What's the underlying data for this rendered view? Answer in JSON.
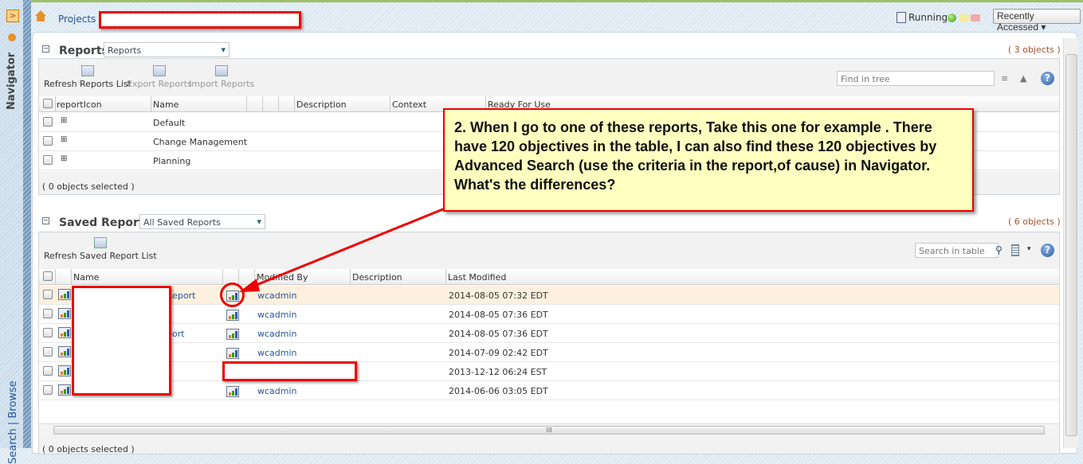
{
  "nav": {
    "title": "Navigator",
    "search_tab": "Search",
    "browse_tab": "Browse",
    "separator": "|"
  },
  "header": {
    "breadcrumb_root": "Projects",
    "breadcrumb_sep": ">",
    "status": "Running",
    "recently_accessed": "Recently Accessed"
  },
  "reports": {
    "title": "Reports",
    "selector": "Reports",
    "count": "( 3 objects )",
    "toolbar": [
      "Refresh Reports List",
      "Export Reports",
      "Import Reports"
    ],
    "find_placeholder": "Find in tree",
    "columns": [
      "reportIcon",
      "Name",
      "",
      "",
      "",
      "Description",
      "Context",
      "Ready For Use"
    ],
    "rows": [
      "Default",
      "Change Management",
      "Planning"
    ],
    "selected": "( 0 objects selected )"
  },
  "saved_reports": {
    "title": "Saved Reports",
    "selector": "All Saved Reports",
    "count": "( 6 objects )",
    "toolbar": [
      "Refresh Saved Report List"
    ],
    "search_placeholder": "Search in table",
    "columns": [
      "Name",
      "Modified By",
      "Description",
      "Last Modified"
    ],
    "rows": [
      {
        "name": "Report",
        "modified_by": "wcadmin",
        "last_modified": "2014-08-05 07:32 EDT"
      },
      {
        "name": "",
        "modified_by": "wcadmin",
        "last_modified": "2014-08-05 07:36 EDT"
      },
      {
        "name": "port",
        "modified_by": "wcadmin",
        "last_modified": "2014-08-05 07:36 EDT"
      },
      {
        "name": "t",
        "modified_by": "wcadmin",
        "last_modified": "2014-07-09 02:42 EDT"
      },
      {
        "name": "",
        "modified_by": "",
        "last_modified": "2013-12-12 06:24 EST"
      },
      {
        "name": "",
        "modified_by": "wcadmin",
        "last_modified": "2014-06-06 03:05 EDT"
      }
    ],
    "selected": "( 0 objects selected )"
  },
  "annotation": {
    "text": "2. When I go to one of these reports, Take this one for example . There have 120 objectives in the table, I can also find these 120 objectives by Advanced Search (use the criteria in the report,of cause) in Navigator. What's the differences?"
  },
  "colors": {
    "annotation_bg": "#ffffc0",
    "annotation_border": "#e00000",
    "link": "#24569b",
    "highlight_row": "#fdf0de"
  }
}
